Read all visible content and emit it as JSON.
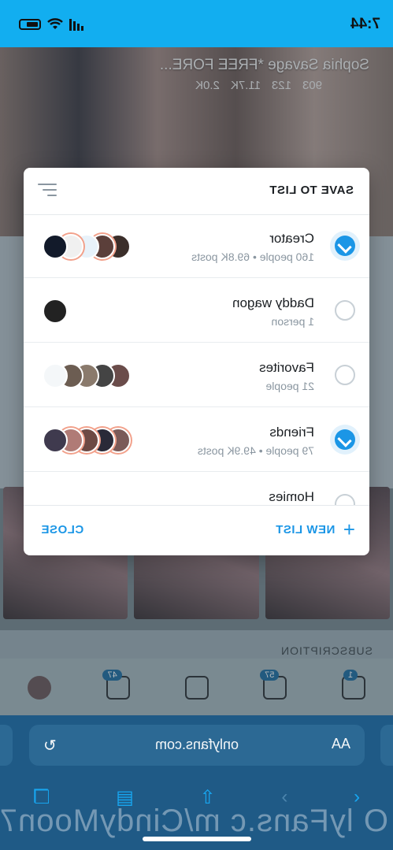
{
  "status_bar": {
    "time": "7:44"
  },
  "profile": {
    "name": "Sophia Savage *FREE FORE...",
    "stats": {
      "photos": "903",
      "videos": "123",
      "likes": "11.7K",
      "subscribers": "2.0K"
    }
  },
  "background": {
    "subscription_label": "SUBSCRIPTION"
  },
  "tab_bar": {
    "notifications_badge": "1",
    "alerts_badge": "57",
    "messages_badge": "47"
  },
  "modal": {
    "title": "SAVE TO LIST",
    "lists": [
      {
        "title": "Creator",
        "subtitle": "160 people • 69.8K posts",
        "checked": true
      },
      {
        "title": "Daddy wagon",
        "subtitle": "1 person",
        "checked": false
      },
      {
        "title": "Favorites",
        "subtitle": "21 people",
        "checked": false
      },
      {
        "title": "Friends",
        "subtitle": "79 people • 49.9K posts",
        "checked": true
      },
      {
        "title": "Homies",
        "subtitle": "",
        "checked": false
      }
    ],
    "new_list_label": "NEW LIST",
    "close_label": "CLOSE"
  },
  "browser": {
    "aa_label": "AA",
    "url": "onlyfans.com"
  },
  "watermark": "O lyFans.c m/CindyMoon7",
  "colors": {
    "accent": "#1b96e6",
    "status_bar": "#12aef0",
    "browser_bar": "#1f5a86"
  }
}
